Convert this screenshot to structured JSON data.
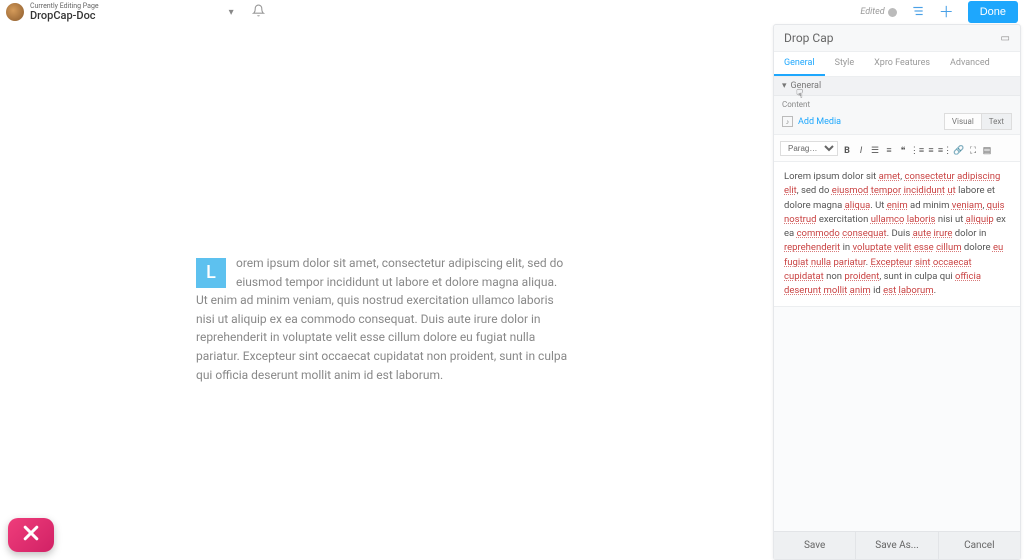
{
  "topbar": {
    "editing_label": "Currently Editing Page",
    "page_title": "DropCap-Doc",
    "edited_label": "Edited",
    "done_label": "Done"
  },
  "preview": {
    "dropcap_letter": "L",
    "body_text": "orem ipsum dolor sit amet, consectetur adipiscing elit, sed do eiusmod tempor incididunt ut labore et dolore magna aliqua. Ut enim ad minim veniam, quis nostrud exercitation ullamco laboris nisi ut aliquip ex ea commodo consequat. Duis aute irure dolor in reprehenderit in voluptate velit esse cillum dolore eu fugiat nulla pariatur. Excepteur sint occaecat cupidatat non proident, sunt in culpa qui officia deserunt mollit anim id est laborum."
  },
  "panel": {
    "title": "Drop Cap",
    "tabs": [
      "General",
      "Style",
      "Xpro Features",
      "Advanced"
    ],
    "active_tab": 0,
    "section_label": "General",
    "content_label": "Content",
    "add_media_label": "Add Media",
    "editor_modes": [
      "Visual",
      "Text"
    ],
    "active_mode": 1,
    "format_selected": "Parag…",
    "toolbar_icons": [
      "bold",
      "italic",
      "list-ul",
      "list-ol",
      "quote",
      "align-left",
      "align-center",
      "align-right",
      "link",
      "fullscreen",
      "more"
    ],
    "rte_tokens": [
      {
        "t": "Lorem ipsum dolor sit "
      },
      {
        "t": "amet",
        "s": 1
      },
      {
        "t": ", "
      },
      {
        "t": "consectetur",
        "s": 1
      },
      {
        "t": " "
      },
      {
        "t": "adipiscing",
        "s": 1
      },
      {
        "t": " "
      },
      {
        "t": "elit",
        "s": 1
      },
      {
        "t": ", sed do "
      },
      {
        "t": "eiusmod",
        "s": 1
      },
      {
        "t": " "
      },
      {
        "t": "tempor",
        "s": 1
      },
      {
        "t": " "
      },
      {
        "t": "incididunt",
        "s": 1
      },
      {
        "t": " "
      },
      {
        "t": "ut",
        "s": 1
      },
      {
        "t": " labore et dolore magna "
      },
      {
        "t": "aliqua",
        "s": 1
      },
      {
        "t": ". Ut "
      },
      {
        "t": "enim",
        "s": 1
      },
      {
        "t": " ad minim "
      },
      {
        "t": "veniam",
        "s": 1
      },
      {
        "t": ", "
      },
      {
        "t": "quis",
        "s": 1
      },
      {
        "t": " "
      },
      {
        "t": "nostrud",
        "s": 1
      },
      {
        "t": " exercitation "
      },
      {
        "t": "ullamco",
        "s": 1
      },
      {
        "t": " "
      },
      {
        "t": "laboris",
        "s": 1
      },
      {
        "t": " nisi ut "
      },
      {
        "t": "aliquip",
        "s": 1
      },
      {
        "t": " ex ea "
      },
      {
        "t": "commodo",
        "s": 1
      },
      {
        "t": " "
      },
      {
        "t": "consequat",
        "s": 1
      },
      {
        "t": ". Duis "
      },
      {
        "t": "aute",
        "s": 1
      },
      {
        "t": " "
      },
      {
        "t": "irure",
        "s": 1
      },
      {
        "t": " dolor in "
      },
      {
        "t": "reprehenderit",
        "s": 1
      },
      {
        "t": " in "
      },
      {
        "t": "voluptate",
        "s": 1
      },
      {
        "t": " "
      },
      {
        "t": "velit",
        "s": 1
      },
      {
        "t": " "
      },
      {
        "t": "esse",
        "s": 1
      },
      {
        "t": " "
      },
      {
        "t": "cillum",
        "s": 1
      },
      {
        "t": " dolore "
      },
      {
        "t": "eu",
        "s": 1
      },
      {
        "t": " "
      },
      {
        "t": "fugiat",
        "s": 1
      },
      {
        "t": " "
      },
      {
        "t": "nulla",
        "s": 1
      },
      {
        "t": " "
      },
      {
        "t": "pariatur",
        "s": 1
      },
      {
        "t": ". "
      },
      {
        "t": "Excepteur",
        "s": 1
      },
      {
        "t": " "
      },
      {
        "t": "sint",
        "s": 1
      },
      {
        "t": " "
      },
      {
        "t": "occaecat",
        "s": 1
      },
      {
        "t": " "
      },
      {
        "t": "cupidatat",
        "s": 1
      },
      {
        "t": " non "
      },
      {
        "t": "proident",
        "s": 1
      },
      {
        "t": ", sunt in culpa qui "
      },
      {
        "t": "officia",
        "s": 1
      },
      {
        "t": " "
      },
      {
        "t": "deserunt",
        "s": 1
      },
      {
        "t": " "
      },
      {
        "t": "mollit",
        "s": 1
      },
      {
        "t": " "
      },
      {
        "t": "anim",
        "s": 1
      },
      {
        "t": " id "
      },
      {
        "t": "est",
        "s": 1
      },
      {
        "t": " "
      },
      {
        "t": "laborum",
        "s": 1
      },
      {
        "t": "."
      }
    ],
    "footer": {
      "save": "Save",
      "save_as": "Save As...",
      "cancel": "Cancel"
    }
  }
}
